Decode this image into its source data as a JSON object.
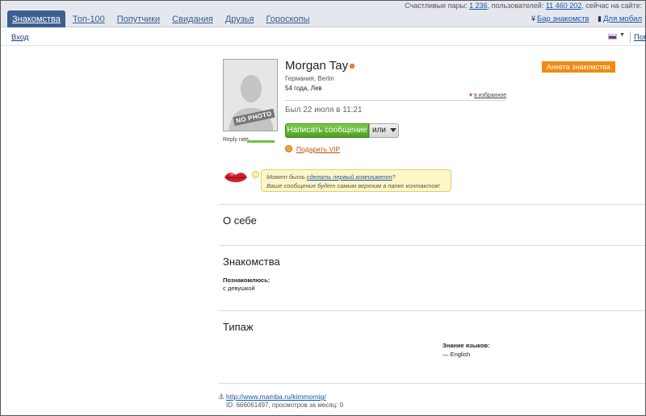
{
  "nav": {
    "tabs": [
      {
        "label": "Знакомства",
        "active": true
      },
      {
        "label": "Топ-100"
      },
      {
        "label": "Попутчики"
      },
      {
        "label": "Свидания"
      },
      {
        "label": "Друзья"
      },
      {
        "label": "Гороскопы"
      }
    ],
    "stats": {
      "pairs_label": "Счастливые пары:",
      "pairs_count": "1 236",
      "users_label": ", пользователей:",
      "users_count": "11 460 202",
      "online_label": ", сейчас на сайте:"
    },
    "links": {
      "bar": "Бар знакомств",
      "mobile": "Для мобил"
    }
  },
  "subbar": {
    "login": "Вход",
    "mobile_short": "Помо"
  },
  "profile": {
    "photo_stamp": "NO PHOTO",
    "reply_rate_label": "Reply rate",
    "name": "Morgan Tay",
    "location": "Германия, Berlin",
    "age_sign": "54 года, Лев",
    "favorite": "в избранное",
    "last_seen": "Был 22 июля в 11:21",
    "write_button": "Написать сообщение",
    "or_button": "или",
    "gift_vip": "Подарить VIP",
    "badge": "Анкета знакомства"
  },
  "tip": {
    "line1_prefix": "Может быть ",
    "line1_link": "сделать первый комплимент",
    "line1_suffix": "?",
    "line2": "Ваше сообщение будет самым верхним в папке контактов!"
  },
  "sections": {
    "about_title": "О себе",
    "dating_title": "Знакомства",
    "dating_label": "Познакомлюсь:",
    "dating_value": "с девушкой",
    "type_title": "Типаж",
    "languages_label": "Знание языков:",
    "languages_value": "— English"
  },
  "footer": {
    "url": "http://www.mamba.ru/kimmornig/",
    "id_line": "ID: 666061497, просмотров за месяц: 0"
  },
  "colors": {
    "nav_active": "#3d5f8f",
    "link": "#1a55a8",
    "green_button": "#4f9f21",
    "badge": "#f28a11"
  }
}
